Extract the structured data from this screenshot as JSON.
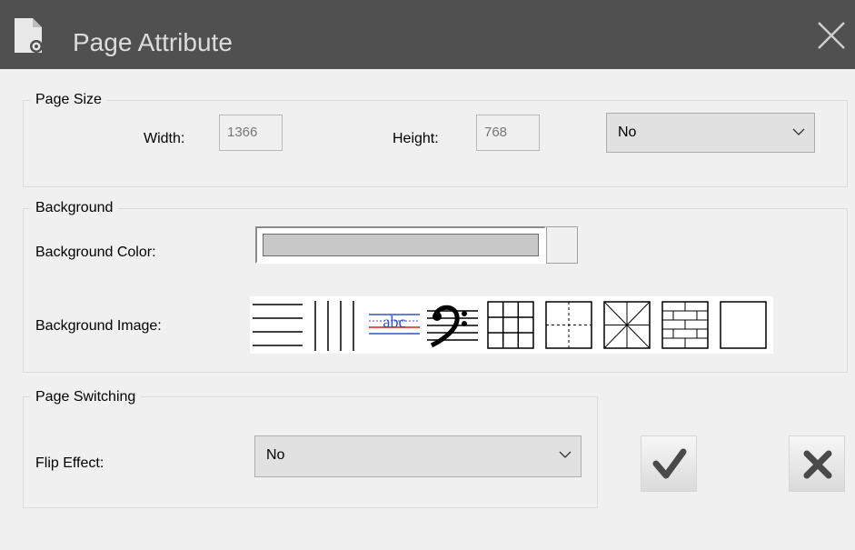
{
  "dialog": {
    "title": "Page Attribute",
    "close_icon": "close-icon",
    "title_bar_color": "#505050"
  },
  "page_size": {
    "legend": "Page Size",
    "width_label": "Width:",
    "width_value": "1366",
    "height_label": "Height:",
    "height_value": "768",
    "preset_selected": "No"
  },
  "background": {
    "legend": "Background",
    "color_label": "Background Color:",
    "color_value": "#c8c8c8",
    "image_label": "Background Image:",
    "image_options": [
      {
        "icon": "horizontal-lines-icon"
      },
      {
        "icon": "vertical-lines-icon"
      },
      {
        "icon": "abc-ruled-lines-icon",
        "text": "abc"
      },
      {
        "icon": "bass-clef-staff-icon"
      },
      {
        "icon": "grid-icon"
      },
      {
        "icon": "dashed-cross-icon"
      },
      {
        "icon": "star-grid-icon"
      },
      {
        "icon": "brick-grid-icon"
      },
      {
        "icon": "blank-icon"
      }
    ]
  },
  "page_switching": {
    "legend": "Page Switching",
    "flip_label": "Flip Effect:",
    "flip_selected": "No"
  },
  "actions": {
    "confirm_icon": "checkmark-icon",
    "cancel_icon": "x-icon"
  }
}
